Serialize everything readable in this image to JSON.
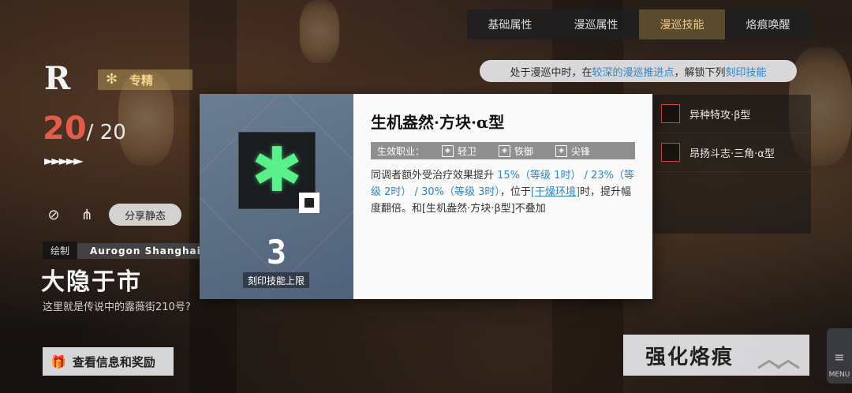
{
  "tabs": [
    {
      "label": "基础属性",
      "active": false
    },
    {
      "label": "漫巡属性",
      "active": false
    },
    {
      "label": "漫巡技能",
      "active": true
    },
    {
      "label": "烙痕唤醒",
      "active": false
    }
  ],
  "unlock_hint": {
    "pre": "处于漫巡中时，在",
    "hl1": "较深的漫巡推进点",
    "mid": "，解锁下列",
    "hl2": "刻印技能"
  },
  "skill_list": [
    {
      "label": "异种特攻·β型"
    },
    {
      "label": "昂扬斗志·三角·α型"
    }
  ],
  "left_panel": {
    "rarity": "R",
    "spec_label": "专精",
    "level_current": "20",
    "level_max": "/ 20",
    "arrows": "►►►►►",
    "share_label": "分享静态",
    "artist_label": "绘制",
    "artist_name": "Aurogon Shanghai",
    "title": "大隐于市",
    "subtitle": "这里就是传说中的露薇街210号?",
    "info_button": "查看信息和奖励"
  },
  "enhance_button": "强化烙痕",
  "menu_label": "MENU",
  "modal": {
    "limit_number": "3",
    "limit_label": "刻印技能上限",
    "skill_name": "生机盎然·方块·α型",
    "class_label": "生效职业：",
    "classes": [
      "轻卫",
      "铁御",
      "尖锋"
    ],
    "desc": {
      "p1": "同调者额外受治疗效果提升 ",
      "v1": "15%（等级 1时）",
      "s1": " / ",
      "v2": "23%（等级 2时）",
      "s2": " / ",
      "v3": "30%（等级 3时）",
      "p2": "，位于",
      "term": "[干燥环境]",
      "p3": "时，提升幅度翻倍。和[生机盎然·方块·β型]不叠加"
    }
  },
  "colors": {
    "accent_gold": "#e9c98c",
    "link_blue": "#2e86c9",
    "level_red": "#e25b4b",
    "skill_green": "#5af08a"
  }
}
